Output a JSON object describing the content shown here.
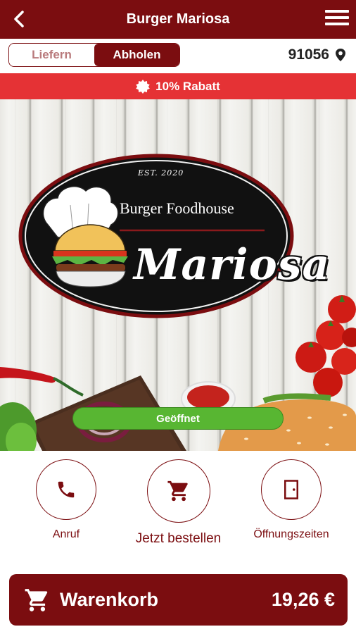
{
  "header": {
    "title": "Burger Mariosa",
    "back_icon": "chevron-left-icon",
    "menu_icon": "hamburger-menu-icon"
  },
  "mode": {
    "options": [
      "Liefern",
      "Abholen"
    ],
    "selected": "Abholen"
  },
  "location": {
    "zip": "91056",
    "icon": "location-pin-icon"
  },
  "promo": {
    "text": "10% Rabatt",
    "icon": "badge-icon"
  },
  "logo": {
    "est": "EST. 2020",
    "line1": "Burger Foodhouse",
    "line2": "Mariosa"
  },
  "status": {
    "text": "Geöffnet",
    "color": "#58b632"
  },
  "actions": [
    {
      "label": "Anruf",
      "icon": "phone-icon"
    },
    {
      "label": "Jetzt bestellen",
      "icon": "cart-icon"
    },
    {
      "label": "Öffnungszeiten",
      "icon": "door-icon"
    }
  ],
  "cart": {
    "label": "Warenkorb",
    "total": "19,26 €",
    "icon": "cart-icon"
  },
  "colors": {
    "brand": "#7b0d10",
    "promo": "#e53235",
    "open": "#58b632"
  }
}
